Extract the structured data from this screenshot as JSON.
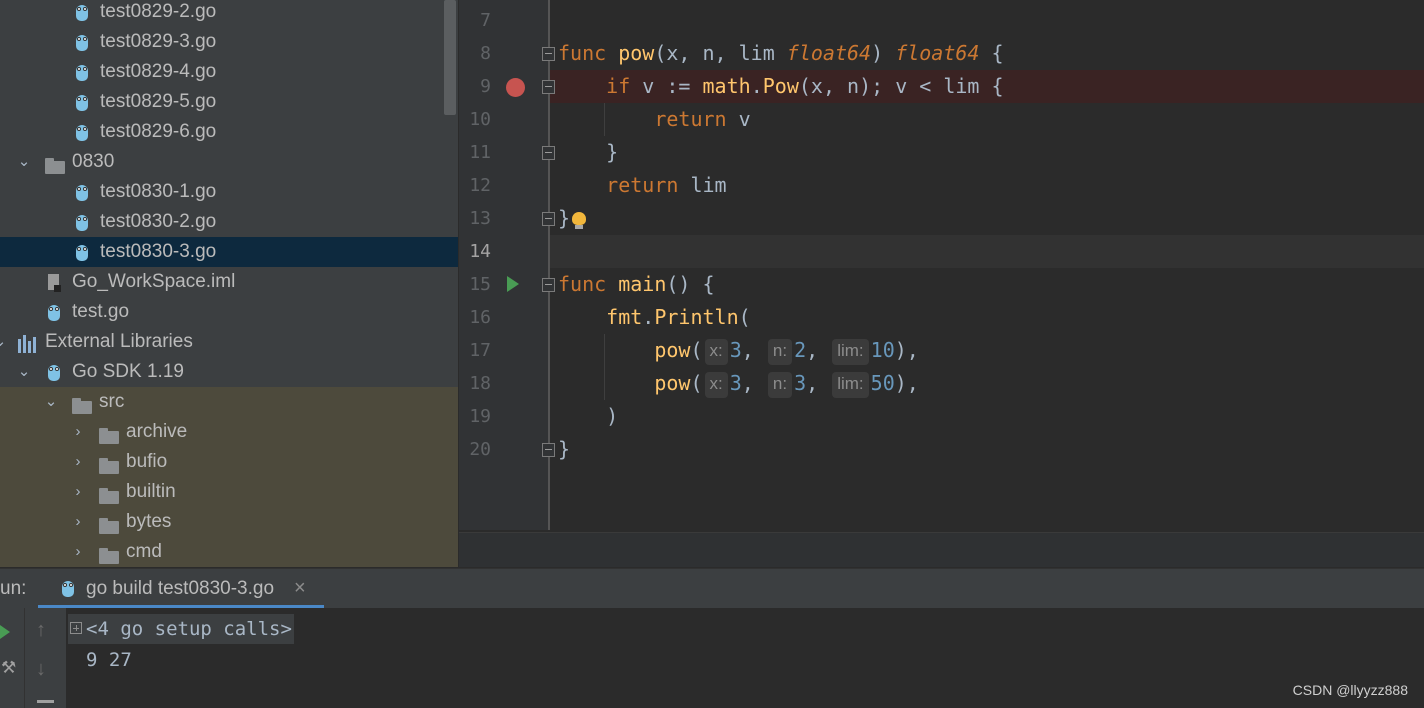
{
  "project_tree": {
    "items": [
      {
        "label": "test0829-2.go",
        "icon": "go-file-icon"
      },
      {
        "label": "test0829-3.go",
        "icon": "go-file-icon"
      },
      {
        "label": "test0829-4.go",
        "icon": "go-file-icon"
      },
      {
        "label": "test0829-5.go",
        "icon": "go-file-icon"
      },
      {
        "label": "test0829-6.go",
        "icon": "go-file-icon"
      },
      {
        "label": "0830",
        "icon": "folder-icon",
        "expanded": true
      },
      {
        "label": "test0830-1.go",
        "icon": "go-file-icon"
      },
      {
        "label": "test0830-2.go",
        "icon": "go-file-icon"
      },
      {
        "label": "test0830-3.go",
        "icon": "go-file-icon",
        "selected": true
      },
      {
        "label": "Go_WorkSpace.iml",
        "icon": "iml-file-icon"
      },
      {
        "label": "test.go",
        "icon": "go-file-icon"
      },
      {
        "label": "External Libraries",
        "icon": "libraries-icon",
        "expanded": true
      },
      {
        "label": "Go SDK 1.19",
        "icon": "go-sdk-icon",
        "expanded": true
      },
      {
        "label": "src",
        "icon": "folder-icon",
        "expanded": true
      },
      {
        "label": "archive",
        "icon": "folder-icon",
        "expanded": false
      },
      {
        "label": "bufio",
        "icon": "folder-icon",
        "expanded": false
      },
      {
        "label": "builtin",
        "icon": "folder-icon",
        "expanded": false
      },
      {
        "label": "bytes",
        "icon": "folder-icon",
        "expanded": false
      },
      {
        "label": "cmd",
        "icon": "folder-icon",
        "expanded": false
      }
    ]
  },
  "editor": {
    "line_numbers": [
      "7",
      "8",
      "9",
      "10",
      "11",
      "12",
      "13",
      "14",
      "15",
      "16",
      "17",
      "18",
      "19",
      "20"
    ],
    "breakpoint_line": "9",
    "current_line": "14",
    "run_gutter_line": "15",
    "code": {
      "l8": {
        "kw": "func",
        "name": "pow",
        "params": "(x, n, lim ",
        "type1": "float64",
        "close": ") ",
        "type2": "float64",
        "brace": " {"
      },
      "l9": {
        "kw": "if",
        "mid": " v := ",
        "pkg": "math",
        "dot": ".",
        "call": "Pow",
        "args": "(x, n); v < lim {"
      },
      "l10": {
        "kw": "return",
        "rest": " v"
      },
      "l11": {
        "text": "}"
      },
      "l12": {
        "kw": "return",
        "rest": " lim"
      },
      "l13": {
        "text": "}"
      },
      "l15": {
        "kw": "func",
        "name": "main",
        "rest": "() {"
      },
      "l16": {
        "pkg": "fmt",
        "dot": ".",
        "call": "Println",
        "rest": "("
      },
      "l17": {
        "call": "pow",
        "open": "(",
        "hint_x": "x:",
        "x": "3",
        "hint_n": "n:",
        "n": "2",
        "hint_lim": "lim:",
        "lim": "10",
        "close": "),"
      },
      "l18": {
        "call": "pow",
        "open": "(",
        "hint_x": "x:",
        "x": "3",
        "hint_n": "n:",
        "n": "3",
        "hint_lim": "lim:",
        "lim": "50",
        "close": "),"
      },
      "l19": {
        "text": ")"
      },
      "l20": {
        "text": "}"
      }
    }
  },
  "run_panel": {
    "label": "un:",
    "tab_label": "go build test0830-3.go",
    "tab_close": "×",
    "setup_calls": "<4 go setup calls>",
    "output": "9 27"
  },
  "watermark": "CSDN @llyyzz888",
  "colors": {
    "keyword": "#cc7832",
    "function": "#ffc66d",
    "number": "#6897bb",
    "breakpoint": "#c75450",
    "run_arrow": "#499c54",
    "selection": "#0d293e"
  }
}
